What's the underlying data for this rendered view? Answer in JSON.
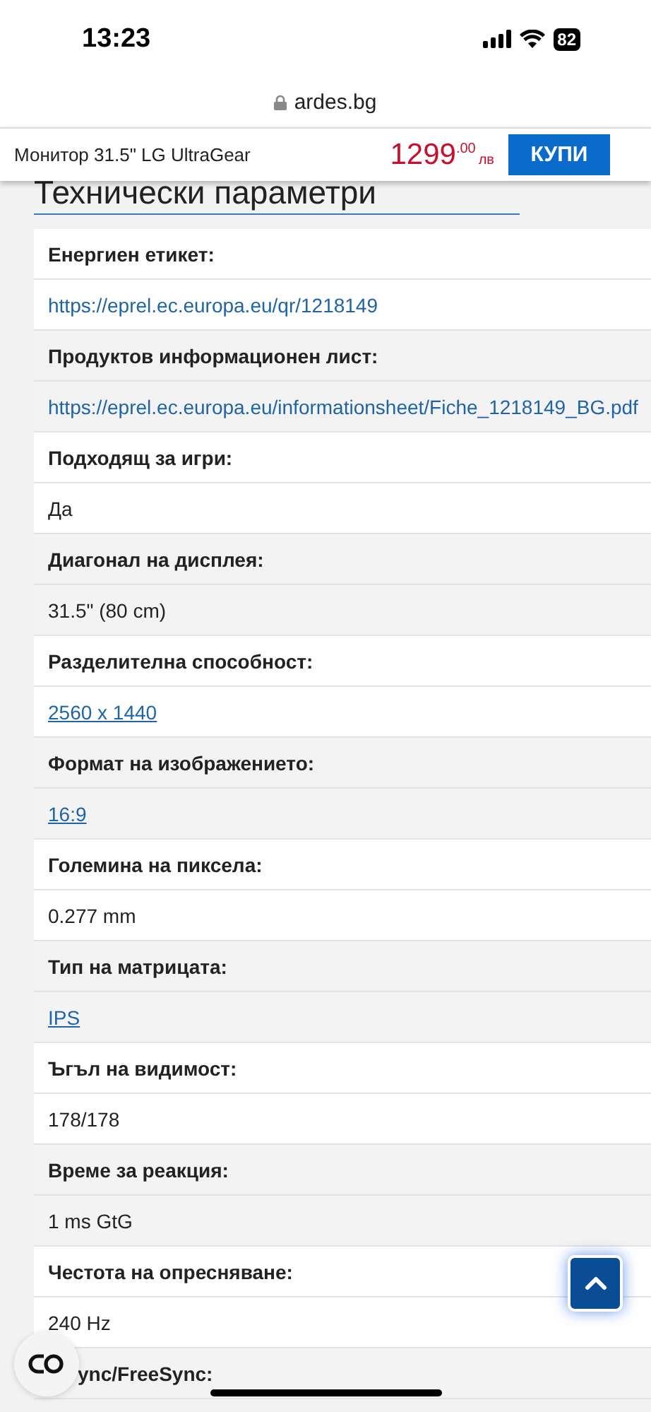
{
  "status_bar": {
    "time": "13:23",
    "battery": "82"
  },
  "browser": {
    "url": "ardes.bg"
  },
  "product_bar": {
    "name": "Монитор 31.5\" LG UltraGear",
    "price": "1299",
    "cents": ".00",
    "currency": "лв",
    "buy_button": "КУПИ"
  },
  "section_title": "Технически параметри",
  "specs": [
    {
      "label": "Енергиен етикет:",
      "value": "https://eprel.ec.europa.eu/qr/1218149",
      "kind": "url"
    },
    {
      "label": "Продуктов информационен лист:",
      "value": "https://eprel.ec.europa.eu/informationsheet/Fiche_1218149_BG.pdf",
      "kind": "url"
    },
    {
      "label": "Подходящ за игри:",
      "value": "Да",
      "kind": "text"
    },
    {
      "label": "Диагонал на дисплея:",
      "value": "31.5\" (80 cm)",
      "kind": "text"
    },
    {
      "label": "Разделителна способност:",
      "value": "2560 x 1440",
      "kind": "link"
    },
    {
      "label": "Формат на изображението:",
      "value": "16:9",
      "kind": "link"
    },
    {
      "label": "Големина на пиксела:",
      "value": "0.277 mm",
      "kind": "text"
    },
    {
      "label": "Тип на матрицата:",
      "value": "IPS",
      "kind": "link"
    },
    {
      "label": "Ъгъл на видимост:",
      "value": "178/178",
      "kind": "text"
    },
    {
      "label": "Време за реакция:",
      "value": "1 ms GtG",
      "kind": "text"
    },
    {
      "label": "Честота на опресняване:",
      "value": "240 Hz",
      "kind": "text"
    },
    {
      "label": "ync/FreeSync:"
    }
  ]
}
